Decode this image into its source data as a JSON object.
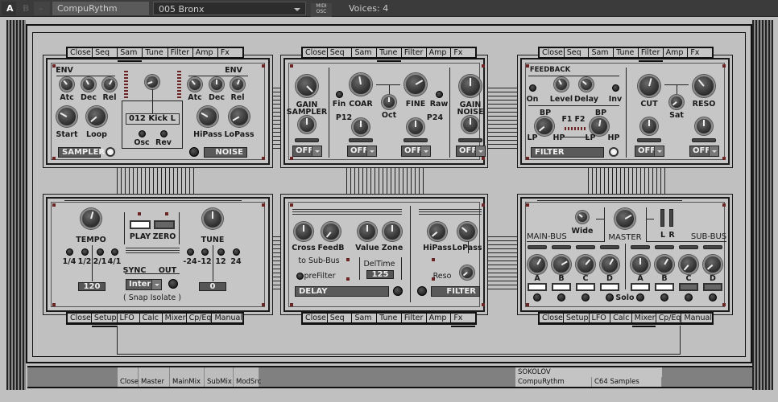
{
  "topbar": {
    "a": "A",
    "b": "B",
    "minus": "–",
    "instrument": "CompuRythm",
    "preset": "005  Bronx",
    "midi": "MIDI",
    "osc": "OSC",
    "voices": "Voices: 4"
  },
  "tabs_top": [
    "Close",
    "Seq",
    "Sam",
    "Tune",
    "Filter",
    "Amp",
    "Fx"
  ],
  "tabs_bottom": [
    "Close",
    "Setup",
    "LFO",
    "Calc",
    "Mixer",
    "Cp/Eq",
    "Manual"
  ],
  "sampler": {
    "env_left": "ENV",
    "env_right": "ENV",
    "atc": "Atc",
    "dec": "Dec",
    "rel": "Rel",
    "start": "Start",
    "loop": "Loop",
    "sample": "012 Kick L",
    "osc": "Osc",
    "rev": "Rev",
    "hipass": "HiPass",
    "lopass": "LoPass",
    "sampler_btn": "SAMPLER",
    "noise_btn": "NOISE"
  },
  "tune": {
    "gain": "GAIN",
    "sampler": "SAMPLER",
    "noise": "NOISE",
    "fin": "Fin",
    "coar": "COAR",
    "oct": "Oct",
    "fine": "FINE",
    "raw": "Raw",
    "p12": "P12",
    "p24": "P24",
    "off": "OFF"
  },
  "filter": {
    "feedback": "FEEDBACK",
    "on": "On",
    "level": "Level",
    "delay": "Delay",
    "inv": "Inv",
    "bp": "BP",
    "lp": "LP",
    "hp": "HP",
    "f1": "F1",
    "f2": "F2",
    "filter_btn": "FILTER",
    "cut": "CUT",
    "reso": "RESO",
    "sat": "Sat",
    "off": "OFF"
  },
  "setup": {
    "tempo": "TEMPO",
    "play": "PLAY",
    "zero": "ZERO",
    "tune": "TUNE",
    "rates": [
      "1/4",
      "1/2",
      "2/1",
      "4/1"
    ],
    "transpose": [
      "-24",
      "-12",
      "12",
      "24"
    ],
    "sync": "SYNC",
    "out": "OUT",
    "sync_value": "Intern",
    "snap": "( Snap Isolate )",
    "tempo_value": "120",
    "tune_value": "0"
  },
  "fx": {
    "cross": "Cross",
    "feedb": "FeedB",
    "value": "Value",
    "zone": "Zone",
    "to_sub_bus": "to Sub-Bus",
    "prefilter": "preFilter",
    "deltime": "DelTime",
    "deltime_value": "125",
    "delay_btn": "DELAY",
    "hipass": "HiPass",
    "lopass": "LoPass",
    "reso": "Reso",
    "filter_btn": "FILTER"
  },
  "mixer": {
    "main_bus": "MAIN-BUS",
    "wide": "Wide",
    "master": "MASTER",
    "l": "L",
    "r": "R",
    "sub_bus": "SUB-BUS",
    "channels": [
      "A",
      "B",
      "C",
      "D"
    ],
    "solo": "Solo"
  },
  "bottom": {
    "tabs": [
      "Close",
      "Master",
      "MainMix",
      "SubMix",
      "ModSrc"
    ],
    "author": "SOKOLOV",
    "instrument": "CompuRythm",
    "category": "C64 Samples"
  }
}
